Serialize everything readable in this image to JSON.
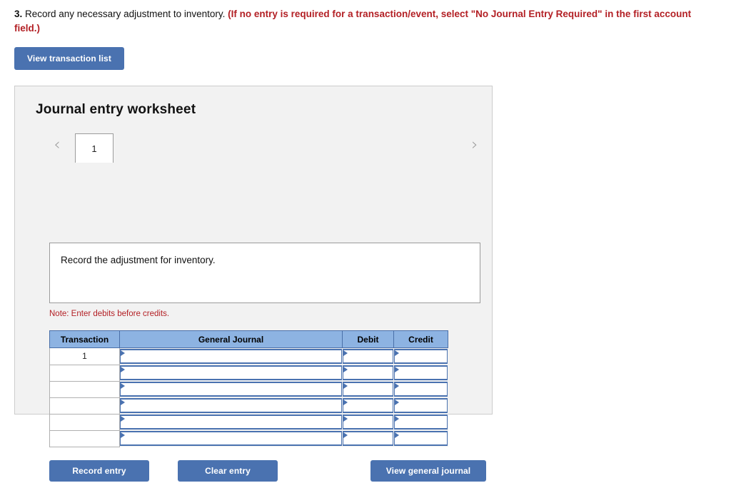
{
  "prompt": {
    "number": "3.",
    "main_text": " Record any necessary adjustment to inventory. ",
    "red_note": "(If no entry is required for a transaction/event, select \"No Journal Entry Required\" in the first account field.)"
  },
  "toolbar": {
    "view_transaction_list_label": "View transaction list"
  },
  "worksheet": {
    "title": "Journal entry worksheet",
    "prev_icon": "‹",
    "next_icon": "›",
    "tabs": [
      {
        "label": "1",
        "active": true
      }
    ],
    "instruction": "Record the adjustment for inventory.",
    "note": "Note: Enter debits before credits."
  },
  "table": {
    "columns": [
      "Transaction",
      "General Journal",
      "Debit",
      "Credit"
    ],
    "rows": [
      {
        "transaction": "1",
        "general_journal": "",
        "debit": "",
        "credit": ""
      },
      {
        "transaction": "",
        "general_journal": "",
        "debit": "",
        "credit": ""
      },
      {
        "transaction": "",
        "general_journal": "",
        "debit": "",
        "credit": ""
      },
      {
        "transaction": "",
        "general_journal": "",
        "debit": "",
        "credit": ""
      },
      {
        "transaction": "",
        "general_journal": "",
        "debit": "",
        "credit": ""
      },
      {
        "transaction": "",
        "general_journal": "",
        "debit": "",
        "credit": ""
      }
    ]
  },
  "actions": {
    "record_entry_label": "Record entry",
    "clear_entry_label": "Clear entry",
    "view_general_journal_label": "View general journal"
  },
  "colors": {
    "button_blue": "#4a72b0",
    "header_blue": "#8db3e2",
    "note_red": "#b32025",
    "panel_grey": "#f2f2f2"
  }
}
